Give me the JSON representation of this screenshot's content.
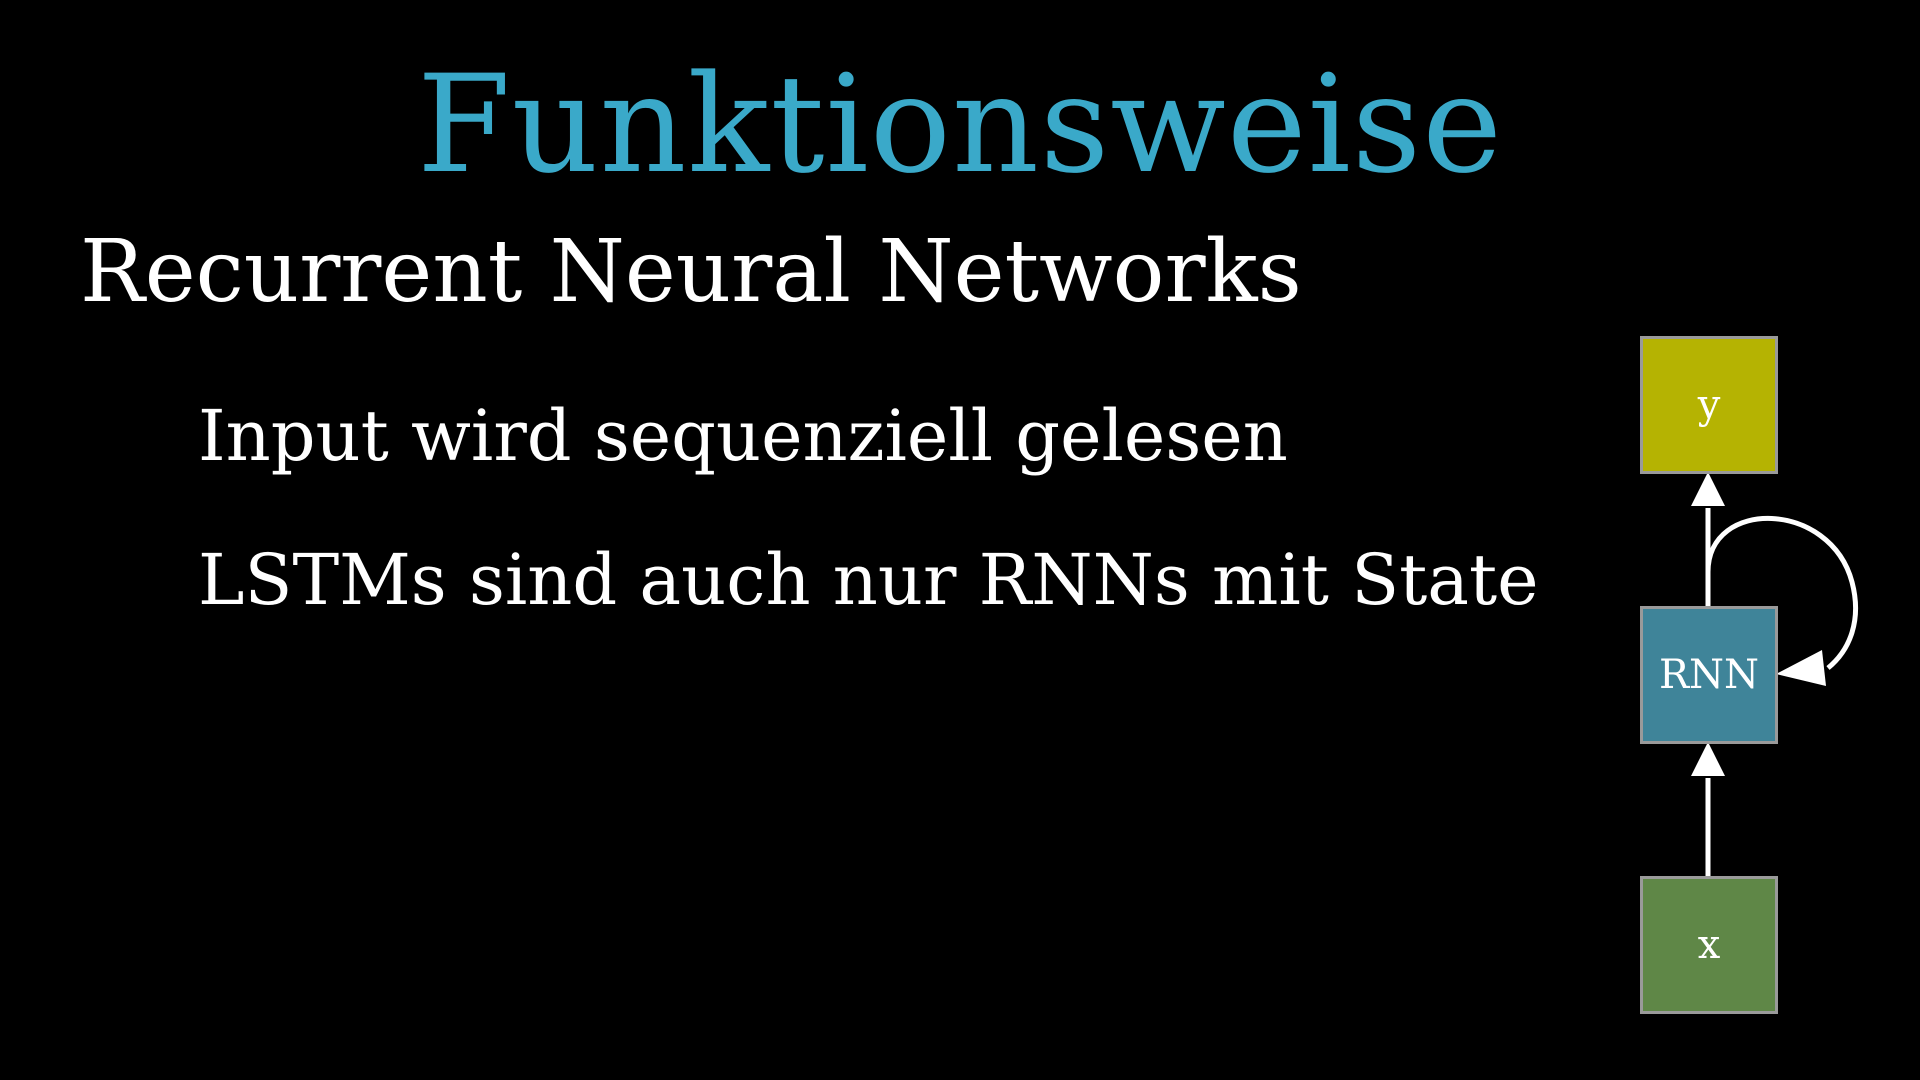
{
  "slide": {
    "title": "Funktionsweise",
    "heading": "Recurrent Neural Networks",
    "bullets": [
      "Input wird sequenziell gelesen",
      "LSTMs sind auch nur RNNs mit State"
    ]
  },
  "diagram": {
    "nodes": {
      "output": "y",
      "rnn": "RNN",
      "input": "x"
    },
    "edges": [
      {
        "from": "x",
        "to": "RNN"
      },
      {
        "from": "RNN",
        "to": "y"
      },
      {
        "from": "RNN",
        "to": "RNN"
      }
    ]
  },
  "colors": {
    "background": "#000000",
    "title": "#3aa9c9",
    "text": "#ffffff",
    "node_y": "#b5b302",
    "node_rnn": "#3f8499",
    "node_x": "#5f8747",
    "node_border": "#9a9a9a",
    "arrow": "#ffffff"
  }
}
